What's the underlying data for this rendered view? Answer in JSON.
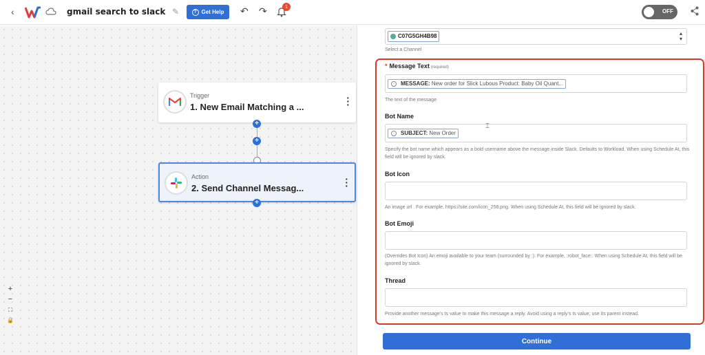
{
  "header": {
    "back_icon": "chevron-left-icon",
    "title": "gmail search to slack",
    "help_label": "Get Help",
    "notification_count": "1",
    "toggle_label": "OFF"
  },
  "canvas": {
    "trigger": {
      "kind": "Trigger",
      "name": "1. New Email Matching a ..."
    },
    "action": {
      "kind": "Action",
      "name": "2. Send Channel Messag..."
    },
    "zoom": {
      "in": "+",
      "out": "−",
      "fit": "⛶",
      "lock": "🔒"
    }
  },
  "panel": {
    "channel": {
      "value": "C07G5GH4B98",
      "help": "Select a Channel"
    },
    "message_text": {
      "label": "Message Text",
      "required": "(required)",
      "token_name": "MESSAGE:",
      "token_value": "New order for Slick Lubous Product: Baby Oil Quant...",
      "help": "The text of the message"
    },
    "bot_name": {
      "label": "Bot Name",
      "token_name": "SUBJECT:",
      "token_value": "New Order",
      "help": "Specify the bot name which appears as a bold username above the message inside Slack. Defaults to Workload. When using Schedule At, this field will be ignored by slack."
    },
    "bot_icon": {
      "label": "Bot Icon",
      "help": "An image url . For example, https://site.com/icon_256.png. When using Schedule At, this field will be ignored by slack."
    },
    "bot_emoji": {
      "label": "Bot Emoji",
      "help": "(Overrides Bot Icon) An emoji available to your team (surrounded by :). For example, :robot_face:. When using Schedule At, this field will be ignored by slack."
    },
    "thread": {
      "label": "Thread",
      "help": "Provide another message's ts value to make this message a reply. Avoid using a reply's ts value; use its parent instead."
    },
    "continue_label": "Continue"
  }
}
